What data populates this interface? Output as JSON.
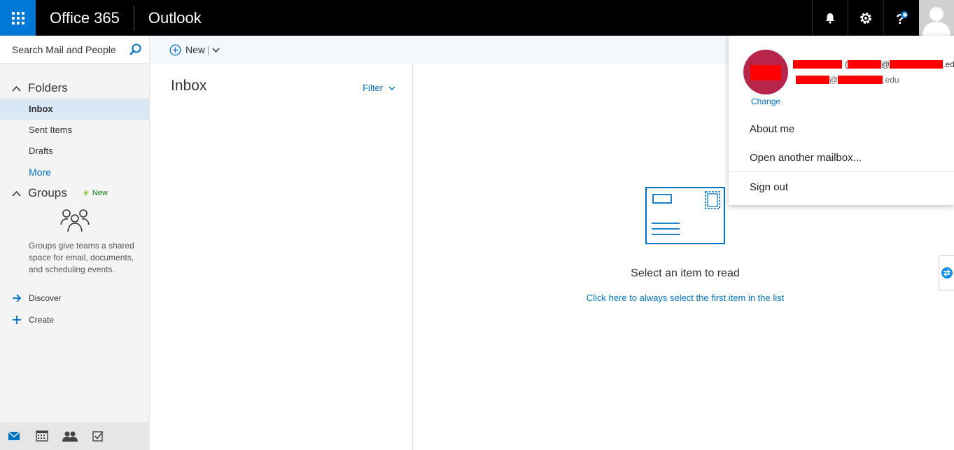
{
  "topbar": {
    "brand": "Office 365",
    "app": "Outlook",
    "icons": [
      "bell-icon",
      "gear-icon",
      "help-icon",
      "avatar"
    ]
  },
  "search": {
    "placeholder": "Search Mail and People"
  },
  "command_bar": {
    "new_label": "New"
  },
  "folders": {
    "heading": "Folders",
    "items": [
      {
        "label": "Inbox",
        "selected": true
      },
      {
        "label": "Sent Items",
        "selected": false
      },
      {
        "label": "Drafts",
        "selected": false
      }
    ],
    "more_label": "More"
  },
  "groups": {
    "heading": "Groups",
    "new_badge": "New",
    "description": "Groups give teams a shared space for email, documents, and scheduling events.",
    "discover_label": "Discover",
    "create_label": "Create"
  },
  "bottom_nav": [
    "mail-icon",
    "calendar-icon",
    "people-icon",
    "tasks-icon"
  ],
  "list": {
    "title": "Inbox",
    "filter_label": "Filter"
  },
  "reading_pane": {
    "empty_title": "Select an item to read",
    "empty_link": "Click here to always select the first item in the list"
  },
  "account_menu": {
    "change_label": "Change",
    "name_suffix": ".edu)",
    "email_suffix": ".edu",
    "about_label": "About me",
    "open_mailbox_label": "Open another mailbox...",
    "sign_out_label": "Sign out"
  },
  "colors": {
    "accent": "#0078d7",
    "link": "#0072c6",
    "avatar_bg": "#b7254a",
    "selected_folder_bg": "#d9e8f6",
    "redaction": "#ff0000"
  }
}
